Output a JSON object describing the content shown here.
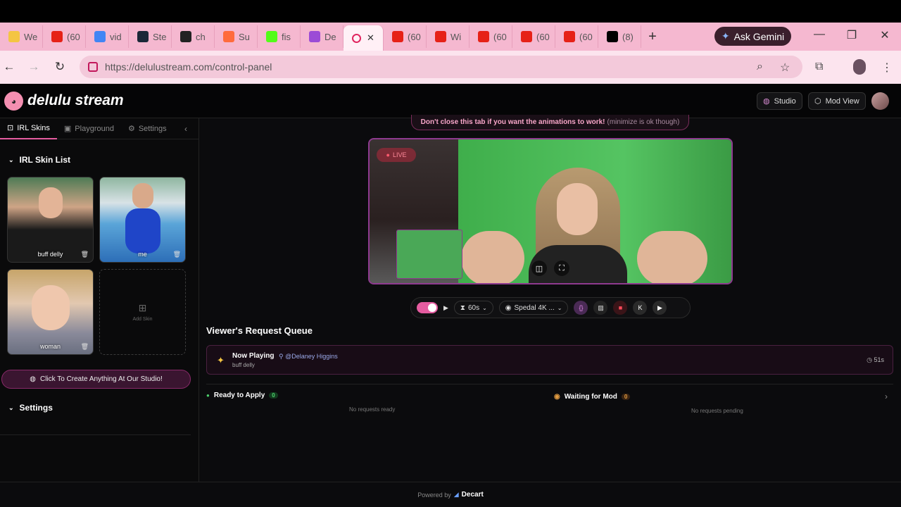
{
  "browser": {
    "tabs": [
      {
        "label": "We",
        "icon": "moon-icon",
        "color": "#f4c542"
      },
      {
        "label": "(60",
        "icon": "youtube-icon",
        "color": "#e62117"
      },
      {
        "label": "vid",
        "icon": "google-icon",
        "color": "#4285f4"
      },
      {
        "label": "Ste",
        "icon": "steam-icon",
        "color": "#1b2838"
      },
      {
        "label": "ch",
        "icon": "app-icon",
        "color": "#222222"
      },
      {
        "label": "Su",
        "icon": "reddit-icon",
        "color": "#ff6b3d"
      },
      {
        "label": "fis",
        "icon": "kick-icon",
        "color": "#53fc18"
      },
      {
        "label": "De",
        "icon": "delulu-icon",
        "color": "#9b4bd6"
      }
    ],
    "active_tab": {
      "icon": "record-icon",
      "color": "#e0245e"
    },
    "tabs_right": [
      {
        "label": "(60",
        "icon": "youtube-icon",
        "color": "#e62117"
      },
      {
        "label": "Wi",
        "icon": "youtube-icon",
        "color": "#e62117"
      },
      {
        "label": "(60",
        "icon": "youtube-icon",
        "color": "#e62117"
      },
      {
        "label": "(60",
        "icon": "youtube-icon",
        "color": "#e62117"
      },
      {
        "label": "(60",
        "icon": "youtube-icon",
        "color": "#e62117"
      },
      {
        "label": "(8)",
        "icon": "x-icon",
        "color": "#000000"
      }
    ],
    "new_tab": "+",
    "ask_gemini": "Ask Gemini",
    "url": "https://delulustream.com/control-panel"
  },
  "app": {
    "brand": "delulu stream",
    "studio_label": "Studio",
    "modview_label": "Mod View"
  },
  "sidebar": {
    "tabs": {
      "irl": "IRL Skins",
      "playground": "Playground",
      "settings": "Settings"
    },
    "skin_list_title": "IRL Skin List",
    "skins": [
      {
        "name": "buff delly"
      },
      {
        "name": "me"
      },
      {
        "name": "woman"
      }
    ],
    "add_skin": "Add Skin",
    "create_button": "Click To Create Anything At Our Studio!",
    "settings_title": "Settings"
  },
  "main": {
    "notice_bold": "Don't close this tab if you want the animations to work!",
    "notice_light": "(minimize is ok though)",
    "live_label": "LIVE",
    "toolbar": {
      "duration": "60s",
      "camera": "Spedal 4K ..."
    },
    "queue_title": "Viewer's Request Queue",
    "now_playing": {
      "title": "Now Playing",
      "user": "@Delaney Higgins",
      "skin": "buff delly",
      "timer": "51s"
    },
    "ready": {
      "title": "Ready to Apply",
      "count": "0",
      "empty": "No requests ready"
    },
    "waiting": {
      "title": "Waiting for Mod",
      "count": "0",
      "empty": "No requests pending"
    }
  },
  "footer": {
    "powered": "Powered by",
    "brand": "Decart"
  },
  "colors": {
    "accent": "#e55ca0",
    "tabstrip": "#f5b8d0",
    "live": "#ff5a6e"
  }
}
